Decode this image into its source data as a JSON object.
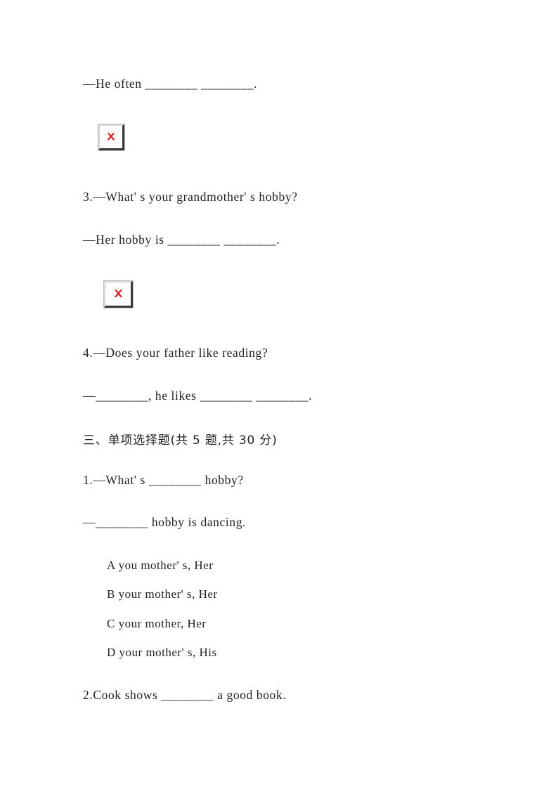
{
  "document": {
    "type": "english-exam-worksheet",
    "page_background": "#ffffff",
    "text_color": "#231f20"
  },
  "fill_in_section": {
    "item2_answer_line": "—He often ________ ________.",
    "item2_image_alt": "broken-image-placeholder",
    "item3_question": "3.—What' s your grandmother' s hobby?",
    "item3_answer_line": "—Her hobby is ________ ________.",
    "item3_image_alt": "broken-image-placeholder",
    "item4_question": "4.—Does your father like reading?",
    "item4_answer_line": "—________, he likes ________ ________."
  },
  "multiple_choice_section": {
    "heading": "三、单项选择题(共 5 题,共 30 分)",
    "questions": [
      {
        "prompt": "1.—What' s ________ hobby?",
        "response": "—________ hobby is dancing.",
        "options": [
          "A you mother' s, Her",
          "B your mother' s, Her",
          "C your mother, Her",
          "D your mother' s, His"
        ]
      },
      {
        "prompt": "2.Cook shows ________ a good book.",
        "response": "",
        "options": []
      }
    ]
  },
  "icons": {
    "broken_image_x_color": "#e01b1b",
    "broken_image_border_color": "#3a3a3a",
    "broken_image_fill": "#fdfdfd"
  }
}
